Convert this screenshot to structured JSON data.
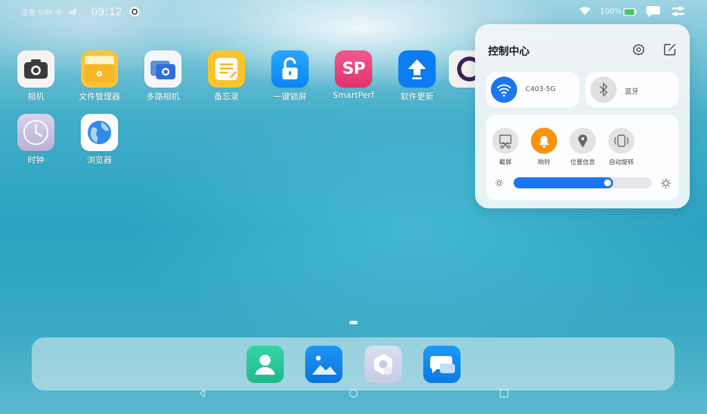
{
  "status": {
    "sim": "没有 SIM 卡",
    "time": "09:12",
    "battery": "100%",
    "battery_level": 1.0
  },
  "apps": [
    {
      "label": "相机",
      "icon": "camera-icon"
    },
    {
      "label": "文件管理器",
      "icon": "folder-icon"
    },
    {
      "label": "多路相机",
      "icon": "multi-camera-icon"
    },
    {
      "label": "备忘录",
      "icon": "memo-icon"
    },
    {
      "label": "一键锁屏",
      "icon": "lock-icon"
    },
    {
      "label": "SmartPerf",
      "icon": "smartperf-icon",
      "badge": "SP"
    },
    {
      "label": "软件更新",
      "icon": "update-icon"
    },
    {
      "label": "时钟",
      "icon": "clock-icon"
    },
    {
      "label": "浏览器",
      "icon": "browser-icon"
    }
  ],
  "dock": [
    {
      "icon": "contacts-icon"
    },
    {
      "icon": "gallery-icon"
    },
    {
      "icon": "settings-app-icon"
    },
    {
      "icon": "messages-icon"
    }
  ],
  "control_center": {
    "title": "控制中心",
    "wifi": {
      "label": "C403-5G",
      "icon": "wifi-icon",
      "on": true
    },
    "bluetooth": {
      "label": "蓝牙",
      "icon": "bluetooth-icon",
      "on": false
    },
    "toggles": [
      {
        "label": "截屏",
        "icon": "screenshot-icon",
        "on": false
      },
      {
        "label": "响铃",
        "icon": "bell-icon",
        "on": true
      },
      {
        "label": "位置信息",
        "icon": "location-icon",
        "on": false
      },
      {
        "label": "自动旋转",
        "icon": "rotate-icon",
        "on": false
      }
    ],
    "brightness": 0.72
  },
  "colors": {
    "accent": "#1976f0",
    "ring_on": "#f7930c"
  }
}
